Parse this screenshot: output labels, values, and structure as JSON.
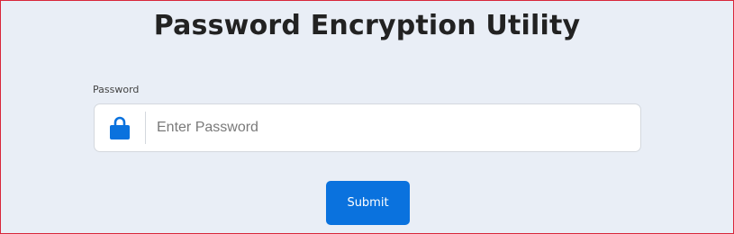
{
  "page": {
    "title": "Password Encryption Utility"
  },
  "form": {
    "password_label": "Password",
    "password_placeholder": "Enter Password",
    "password_value": "",
    "password_icon": "lock-icon",
    "submit_label": "Submit"
  },
  "colors": {
    "background": "#e9eef6",
    "accent": "#0a72de",
    "frame_border": "#d9263a"
  }
}
